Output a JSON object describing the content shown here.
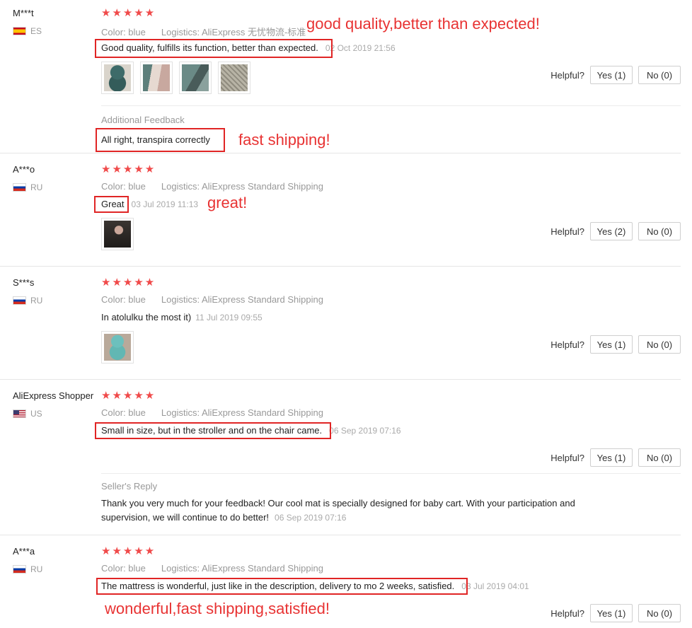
{
  "helpful_label": "Helpful?",
  "reviews": [
    {
      "name": "M***t",
      "country": "ES",
      "stars": "★★★★★",
      "color": "Color: blue",
      "logistics": "Logistics: AliExpress 无忧物流-标准",
      "text": "Good quality, fulfills its function, better than expected.",
      "time": "02 Oct 2019 21:56",
      "annotation": "good quality,better than expected!",
      "yes": "Yes (1)",
      "no": "No (0)",
      "thumb_count": 4,
      "additional_label": "Additional Feedback",
      "additional_text": "All right, transpira correctly",
      "additional_annotation": "fast shipping!"
    },
    {
      "name": "A***o",
      "country": "RU",
      "stars": "★★★★★",
      "color": "Color: blue",
      "logistics": "Logistics: AliExpress Standard Shipping",
      "text": "Great",
      "time": "03 Jul 2019 11:13",
      "annotation": "great!",
      "yes": "Yes (2)",
      "no": "No (0)",
      "thumb_count": 1
    },
    {
      "name": "S***s",
      "country": "RU",
      "stars": "★★★★★",
      "color": "Color: blue",
      "logistics": "Logistics: AliExpress Standard Shipping",
      "text": "In atolulku the most it)",
      "time": "11 Jul 2019 09:55",
      "yes": "Yes (1)",
      "no": "No (0)",
      "thumb_count": 1
    },
    {
      "name": "AliExpress Shopper",
      "country": "US",
      "stars": "★★★★★",
      "color": "Color: blue",
      "logistics": "Logistics: AliExpress Standard Shipping",
      "text": "Small in size, but in the stroller and on the chair came.",
      "time": "06 Sep 2019 07:16",
      "yes": "Yes (1)",
      "no": "No (0)",
      "seller_reply_label": "Seller's Reply",
      "seller_reply_text": "Thank you very much for your feedback! Our cool mat is specially designed for baby cart. With your participation and supervision, we will continue to do better!",
      "seller_reply_time": "06 Sep 2019 07:16"
    },
    {
      "name": "A***a",
      "country": "RU",
      "stars": "★★★★★",
      "color": "Color: blue",
      "logistics": "Logistics: AliExpress Standard Shipping",
      "text": "The mattress is wonderful, just like in the description, delivery to mo 2 weeks, satisfied.",
      "time": "03 Jul 2019 04:01",
      "annotation": "wonderful,fast shipping,satisfied!",
      "yes": "Yes (1)",
      "no": "No (0)"
    }
  ]
}
